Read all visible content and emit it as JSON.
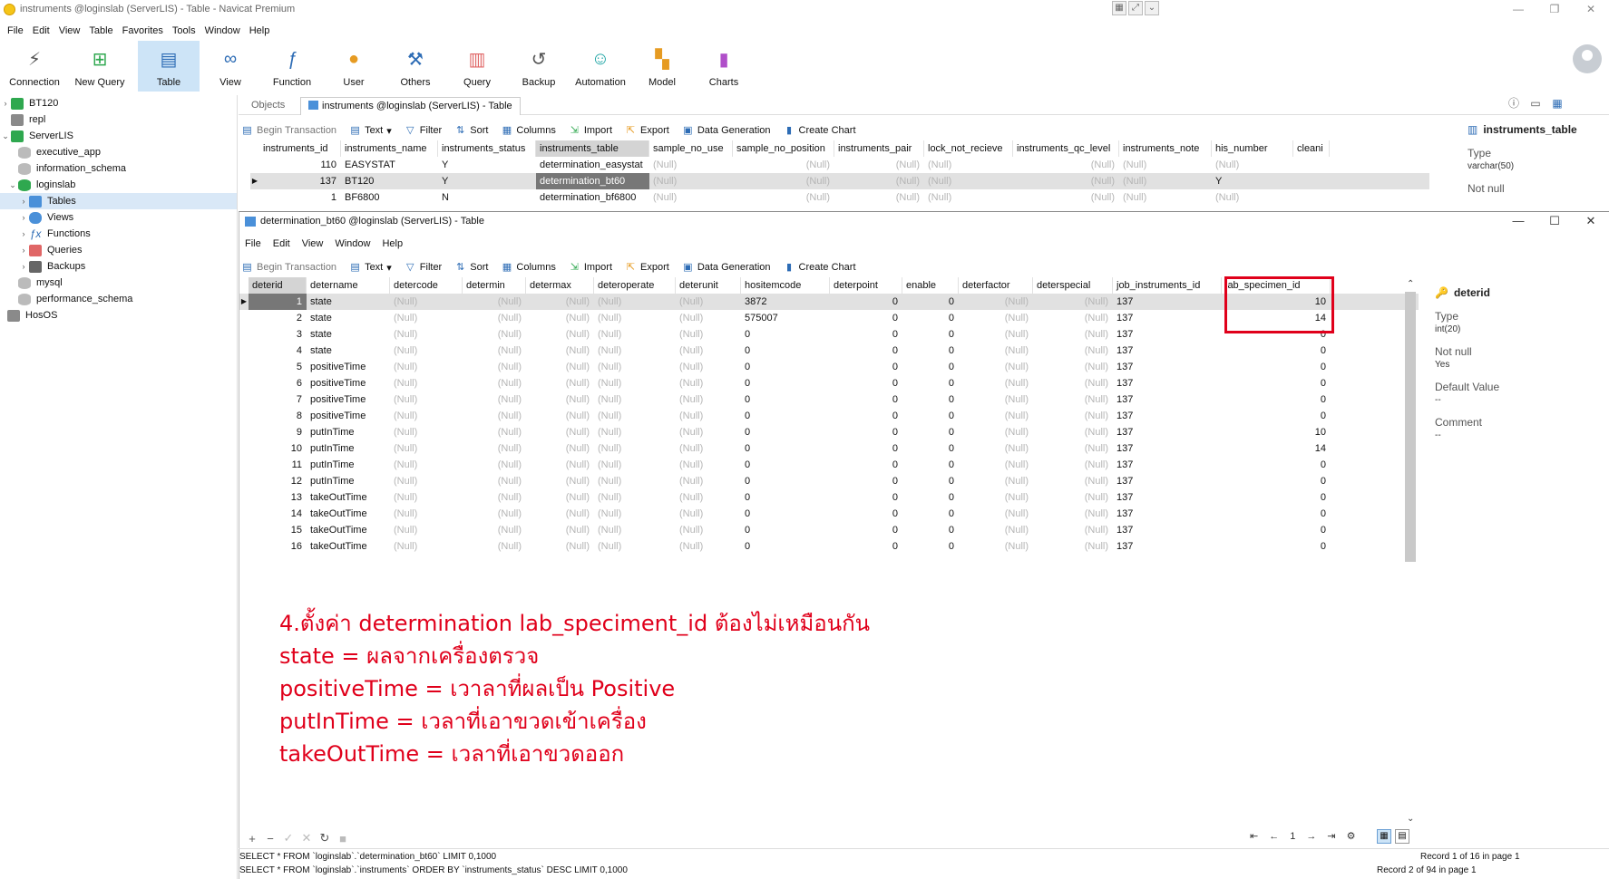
{
  "window": {
    "title": "instruments @loginslab (ServerLIS) - Table - Navicat Premium"
  },
  "menubar": [
    "File",
    "Edit",
    "View",
    "Table",
    "Favorites",
    "Tools",
    "Window",
    "Help"
  ],
  "toolbar": [
    {
      "label": "Connection",
      "icon": "plug-icon"
    },
    {
      "label": "New Query",
      "icon": "new-query-icon"
    },
    {
      "label": "Table",
      "icon": "table-icon"
    },
    {
      "label": "View",
      "icon": "glasses-icon"
    },
    {
      "label": "Function",
      "icon": "function-icon"
    },
    {
      "label": "User",
      "icon": "user-icon"
    },
    {
      "label": "Others",
      "icon": "tools-icon"
    },
    {
      "label": "Query",
      "icon": "query-icon"
    },
    {
      "label": "Backup",
      "icon": "backup-icon"
    },
    {
      "label": "Automation",
      "icon": "robot-icon"
    },
    {
      "label": "Model",
      "icon": "model-icon"
    },
    {
      "label": "Charts",
      "icon": "charts-icon"
    }
  ],
  "sidebar": {
    "items": [
      {
        "label": "BT120"
      },
      {
        "label": "repl"
      },
      {
        "label": "ServerLIS"
      },
      {
        "label": "executive_app"
      },
      {
        "label": "information_schema"
      },
      {
        "label": "loginslab"
      },
      {
        "label": "Tables"
      },
      {
        "label": "Views"
      },
      {
        "label": "Functions"
      },
      {
        "label": "Queries"
      },
      {
        "label": "Backups"
      },
      {
        "label": "mysql"
      },
      {
        "label": "performance_schema"
      },
      {
        "label": "HosOS"
      }
    ]
  },
  "tabs": {
    "objects": "Objects",
    "active": "instruments @loginslab (ServerLIS) - Table"
  },
  "table_toolbar": {
    "begin_transaction": "Begin Transaction",
    "text": "Text",
    "filter": "Filter",
    "sort": "Sort",
    "columns": "Columns",
    "import": "Import",
    "export": "Export",
    "data_generation": "Data Generation",
    "create_chart": "Create Chart"
  },
  "instruments_grid": {
    "columns": [
      "instruments_id",
      "instruments_name",
      "instruments_status",
      "instruments_table",
      "sample_no_use",
      "sample_no_position",
      "instruments_pair",
      "lock_not_recieve",
      "instruments_qc_level",
      "instruments_note",
      "his_number",
      "cleani"
    ],
    "rows": [
      [
        "110",
        "EASYSTAT",
        "Y",
        "determination_easystat",
        "(Null)",
        "(Null)",
        "(Null)",
        "(Null)",
        "(Null)",
        "(Null)",
        "(Null)",
        ""
      ],
      [
        "137",
        "BT120",
        "Y",
        "determination_bt60",
        "(Null)",
        "(Null)",
        "(Null)",
        "(Null)",
        "(Null)",
        "(Null)",
        "Y",
        ""
      ],
      [
        "1",
        "BF6800",
        "N",
        "determination_bf6800",
        "(Null)",
        "(Null)",
        "(Null)",
        "(Null)",
        "(Null)",
        "(Null)",
        "(Null)",
        ""
      ]
    ]
  },
  "instruments_props": {
    "name": "instruments_table",
    "type_label": "Type",
    "type_value": "varchar(50)",
    "not_null_label": "Not null"
  },
  "inner_window": {
    "title": "determination_bt60 @loginslab (ServerLIS) - Table",
    "menu": [
      "File",
      "Edit",
      "View",
      "Window",
      "Help"
    ]
  },
  "det_grid": {
    "columns": [
      "deterid",
      "detername",
      "detercode",
      "determin",
      "determax",
      "deteroperate",
      "deterunit",
      "hositemcode",
      "deterpoint",
      "enable",
      "deterfactor",
      "deterspecial",
      "job_instruments_id",
      "lab_specimen_id"
    ],
    "rows": [
      [
        "1",
        "state",
        "(Null)",
        "(Null)",
        "(Null)",
        "(Null)",
        "(Null)",
        "3872",
        "0",
        "0",
        "(Null)",
        "(Null)",
        "137",
        "10"
      ],
      [
        "2",
        "state",
        "(Null)",
        "(Null)",
        "(Null)",
        "(Null)",
        "(Null)",
        "575007",
        "0",
        "0",
        "(Null)",
        "(Null)",
        "137",
        "14"
      ],
      [
        "3",
        "state",
        "(Null)",
        "(Null)",
        "(Null)",
        "(Null)",
        "(Null)",
        "0",
        "0",
        "0",
        "(Null)",
        "(Null)",
        "137",
        "0"
      ],
      [
        "4",
        "state",
        "(Null)",
        "(Null)",
        "(Null)",
        "(Null)",
        "(Null)",
        "0",
        "0",
        "0",
        "(Null)",
        "(Null)",
        "137",
        "0"
      ],
      [
        "5",
        "positiveTime",
        "(Null)",
        "(Null)",
        "(Null)",
        "(Null)",
        "(Null)",
        "0",
        "0",
        "0",
        "(Null)",
        "(Null)",
        "137",
        "0"
      ],
      [
        "6",
        "positiveTime",
        "(Null)",
        "(Null)",
        "(Null)",
        "(Null)",
        "(Null)",
        "0",
        "0",
        "0",
        "(Null)",
        "(Null)",
        "137",
        "0"
      ],
      [
        "7",
        "positiveTime",
        "(Null)",
        "(Null)",
        "(Null)",
        "(Null)",
        "(Null)",
        "0",
        "0",
        "0",
        "(Null)",
        "(Null)",
        "137",
        "0"
      ],
      [
        "8",
        "positiveTime",
        "(Null)",
        "(Null)",
        "(Null)",
        "(Null)",
        "(Null)",
        "0",
        "0",
        "0",
        "(Null)",
        "(Null)",
        "137",
        "0"
      ],
      [
        "9",
        "putInTime",
        "(Null)",
        "(Null)",
        "(Null)",
        "(Null)",
        "(Null)",
        "0",
        "0",
        "0",
        "(Null)",
        "(Null)",
        "137",
        "10"
      ],
      [
        "10",
        "putInTime",
        "(Null)",
        "(Null)",
        "(Null)",
        "(Null)",
        "(Null)",
        "0",
        "0",
        "0",
        "(Null)",
        "(Null)",
        "137",
        "14"
      ],
      [
        "11",
        "putInTime",
        "(Null)",
        "(Null)",
        "(Null)",
        "(Null)",
        "(Null)",
        "0",
        "0",
        "0",
        "(Null)",
        "(Null)",
        "137",
        "0"
      ],
      [
        "12",
        "putInTime",
        "(Null)",
        "(Null)",
        "(Null)",
        "(Null)",
        "(Null)",
        "0",
        "0",
        "0",
        "(Null)",
        "(Null)",
        "137",
        "0"
      ],
      [
        "13",
        "takeOutTime",
        "(Null)",
        "(Null)",
        "(Null)",
        "(Null)",
        "(Null)",
        "0",
        "0",
        "0",
        "(Null)",
        "(Null)",
        "137",
        "0"
      ],
      [
        "14",
        "takeOutTime",
        "(Null)",
        "(Null)",
        "(Null)",
        "(Null)",
        "(Null)",
        "0",
        "0",
        "0",
        "(Null)",
        "(Null)",
        "137",
        "0"
      ],
      [
        "15",
        "takeOutTime",
        "(Null)",
        "(Null)",
        "(Null)",
        "(Null)",
        "(Null)",
        "0",
        "0",
        "0",
        "(Null)",
        "(Null)",
        "137",
        "0"
      ],
      [
        "16",
        "takeOutTime",
        "(Null)",
        "(Null)",
        "(Null)",
        "(Null)",
        "(Null)",
        "0",
        "0",
        "0",
        "(Null)",
        "(Null)",
        "137",
        "0"
      ]
    ]
  },
  "det_props": {
    "name": "deterid",
    "type_label": "Type",
    "type_value": "int(20)",
    "not_null_label": "Not null",
    "not_null_value": "Yes",
    "default_label": "Default Value",
    "default_value": "--",
    "comment_label": "Comment",
    "comment_value": "--"
  },
  "annotation": {
    "lines": [
      "4.ตั้งค่า determination lab_speciment_id ต้องไม่เหมือนกัน",
      "state = ผลจากเครื่องตรวจ",
      "positiveTime = เวาลาที่ผลเป็น Positive",
      "putInTime = เวลาที่เอาขวดเข้าเครื่อง",
      "takeOutTime = เวลาที่เอาขวดออก"
    ]
  },
  "inner_pager": {
    "page": "1"
  },
  "status": {
    "inner_sql": "SELECT * FROM `loginslab`.`determination_bt60` LIMIT 0,1000",
    "inner_record": "Record 1 of 16 in page 1",
    "outer_sql": "SELECT * FROM `loginslab`.`instruments` ORDER BY `instruments_status` DESC LIMIT 0,1000",
    "outer_record": "Record 2 of 94 in page 1"
  },
  "colors": {
    "annotation_red": "#e0001b",
    "selection_blue": "#cde4f7",
    "null_gray": "#b5b5b5"
  }
}
